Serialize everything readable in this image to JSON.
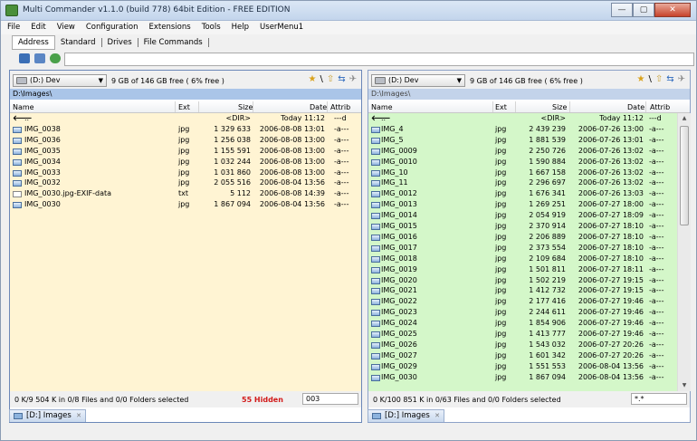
{
  "window": {
    "title": "Multi Commander v1.1.0 (build 778) 64bit Edition - FREE EDITION",
    "min_symbol": "—",
    "max_symbol": "▢",
    "close_symbol": "✕"
  },
  "menu": [
    "File",
    "Edit",
    "View",
    "Configuration",
    "Extensions",
    "Tools",
    "Help",
    "UserMenu1"
  ],
  "toolbar_tabs": [
    {
      "label": "Address",
      "selected": true
    },
    {
      "label": "Standard",
      "selected": false
    },
    {
      "label": "Drives",
      "selected": false
    },
    {
      "label": "File Commands",
      "selected": false
    }
  ],
  "command_icons": [
    "back-icon",
    "edit-icon",
    "globe-icon"
  ],
  "columns": {
    "name": "Name",
    "ext": "Ext",
    "size": "Size",
    "date": "Date",
    "attrib": "Attrib"
  },
  "left": {
    "drive": "(D:) Dev",
    "free": "9 GB of 146 GB free ( 6% free )",
    "path": "D:\\Images\\",
    "rows": [
      {
        "name": "..",
        "ext": "",
        "size": "<DIR>",
        "date": "Today 11:12",
        "attrib": "---d",
        "icon": "up"
      },
      {
        "name": "IMG_0038",
        "ext": "jpg",
        "size": "1 329 633",
        "date": "2006-08-08 13:01",
        "attrib": "-a---",
        "icon": "img"
      },
      {
        "name": "IMG_0036",
        "ext": "jpg",
        "size": "1 256 038",
        "date": "2006-08-08 13:00",
        "attrib": "-a---",
        "icon": "img"
      },
      {
        "name": "IMG_0035",
        "ext": "jpg",
        "size": "1 155 591",
        "date": "2006-08-08 13:00",
        "attrib": "-a---",
        "icon": "img"
      },
      {
        "name": "IMG_0034",
        "ext": "jpg",
        "size": "1 032 244",
        "date": "2006-08-08 13:00",
        "attrib": "-a---",
        "icon": "img"
      },
      {
        "name": "IMG_0033",
        "ext": "jpg",
        "size": "1 031 860",
        "date": "2006-08-08 13:00",
        "attrib": "-a---",
        "icon": "img"
      },
      {
        "name": "IMG_0032",
        "ext": "jpg",
        "size": "2 055 516",
        "date": "2006-08-04 13:56",
        "attrib": "-a---",
        "icon": "img"
      },
      {
        "name": "IMG_0030.jpg-EXIF-data",
        "ext": "txt",
        "size": "5 112",
        "date": "2006-08-08 14:39",
        "attrib": "-a---",
        "icon": "txt"
      },
      {
        "name": "IMG_0030",
        "ext": "jpg",
        "size": "1 867 094",
        "date": "2006-08-04 13:56",
        "attrib": "-a---",
        "icon": "img"
      }
    ],
    "status": "0 K/9 504 K in 0/8 Files and 0/0 Folders selected",
    "hidden": "55 Hidden",
    "filter": "003",
    "tab": "[D:] Images"
  },
  "right": {
    "drive": "(D:) Dev",
    "free": "9 GB of 146 GB free ( 6% free )",
    "path": "D:\\Images\\",
    "rows": [
      {
        "name": "..",
        "ext": "",
        "size": "<DIR>",
        "date": "Today 11:12",
        "attrib": "---d",
        "icon": "up"
      },
      {
        "name": "IMG_4",
        "ext": "jpg",
        "size": "2 439 239",
        "date": "2006-07-26 13:00",
        "attrib": "-a---",
        "icon": "img"
      },
      {
        "name": "IMG_5",
        "ext": "jpg",
        "size": "1 881 539",
        "date": "2006-07-26 13:01",
        "attrib": "-a---",
        "icon": "img"
      },
      {
        "name": "IMG_0009",
        "ext": "jpg",
        "size": "2 250 726",
        "date": "2006-07-26 13:02",
        "attrib": "-a---",
        "icon": "img"
      },
      {
        "name": "IMG_0010",
        "ext": "jpg",
        "size": "1 590 884",
        "date": "2006-07-26 13:02",
        "attrib": "-a---",
        "icon": "img"
      },
      {
        "name": "IMG_10",
        "ext": "jpg",
        "size": "1 667 158",
        "date": "2006-07-26 13:02",
        "attrib": "-a---",
        "icon": "img"
      },
      {
        "name": "IMG_11",
        "ext": "jpg",
        "size": "2 296 697",
        "date": "2006-07-26 13:02",
        "attrib": "-a---",
        "icon": "img"
      },
      {
        "name": "IMG_0012",
        "ext": "jpg",
        "size": "1 676 341",
        "date": "2006-07-26 13:03",
        "attrib": "-a---",
        "icon": "img"
      },
      {
        "name": "IMG_0013",
        "ext": "jpg",
        "size": "1 269 251",
        "date": "2006-07-27 18:00",
        "attrib": "-a---",
        "icon": "img"
      },
      {
        "name": "IMG_0014",
        "ext": "jpg",
        "size": "2 054 919",
        "date": "2006-07-27 18:09",
        "attrib": "-a---",
        "icon": "img"
      },
      {
        "name": "IMG_0015",
        "ext": "jpg",
        "size": "2 370 914",
        "date": "2006-07-27 18:10",
        "attrib": "-a---",
        "icon": "img"
      },
      {
        "name": "IMG_0016",
        "ext": "jpg",
        "size": "2 206 889",
        "date": "2006-07-27 18:10",
        "attrib": "-a---",
        "icon": "img"
      },
      {
        "name": "IMG_0017",
        "ext": "jpg",
        "size": "2 373 554",
        "date": "2006-07-27 18:10",
        "attrib": "-a---",
        "icon": "img"
      },
      {
        "name": "IMG_0018",
        "ext": "jpg",
        "size": "2 109 684",
        "date": "2006-07-27 18:10",
        "attrib": "-a---",
        "icon": "img"
      },
      {
        "name": "IMG_0019",
        "ext": "jpg",
        "size": "1 501 811",
        "date": "2006-07-27 18:11",
        "attrib": "-a---",
        "icon": "img"
      },
      {
        "name": "IMG_0020",
        "ext": "jpg",
        "size": "1 502 219",
        "date": "2006-07-27 19:15",
        "attrib": "-a---",
        "icon": "img"
      },
      {
        "name": "IMG_0021",
        "ext": "jpg",
        "size": "1 412 732",
        "date": "2006-07-27 19:15",
        "attrib": "-a---",
        "icon": "img"
      },
      {
        "name": "IMG_0022",
        "ext": "jpg",
        "size": "2 177 416",
        "date": "2006-07-27 19:46",
        "attrib": "-a---",
        "icon": "img"
      },
      {
        "name": "IMG_0023",
        "ext": "jpg",
        "size": "2 244 611",
        "date": "2006-07-27 19:46",
        "attrib": "-a---",
        "icon": "img"
      },
      {
        "name": "IMG_0024",
        "ext": "jpg",
        "size": "1 854 906",
        "date": "2006-07-27 19:46",
        "attrib": "-a---",
        "icon": "img"
      },
      {
        "name": "IMG_0025",
        "ext": "jpg",
        "size": "1 413 777",
        "date": "2006-07-27 19:46",
        "attrib": "-a---",
        "icon": "img"
      },
      {
        "name": "IMG_0026",
        "ext": "jpg",
        "size": "1 543 032",
        "date": "2006-07-27 20:26",
        "attrib": "-a---",
        "icon": "img"
      },
      {
        "name": "IMG_0027",
        "ext": "jpg",
        "size": "1 601 342",
        "date": "2006-07-27 20:26",
        "attrib": "-a---",
        "icon": "img"
      },
      {
        "name": "IMG_0029",
        "ext": "jpg",
        "size": "1 551 553",
        "date": "2006-08-04 13:56",
        "attrib": "-a---",
        "icon": "img"
      },
      {
        "name": "IMG_0030",
        "ext": "jpg",
        "size": "1 867 094",
        "date": "2006-08-04 13:56",
        "attrib": "-a---",
        "icon": "img"
      }
    ],
    "status": "0 K/100 851 K in 0/63 Files and 0/0 Folders selected",
    "filter": "*.*",
    "tab": "[D:] Images"
  },
  "colors": {
    "left_list_bg": "#fff4d3",
    "right_list_bg": "#d4f7c9",
    "hidden_text": "#d21a1a",
    "left_path_bg": "#aac5e8"
  }
}
